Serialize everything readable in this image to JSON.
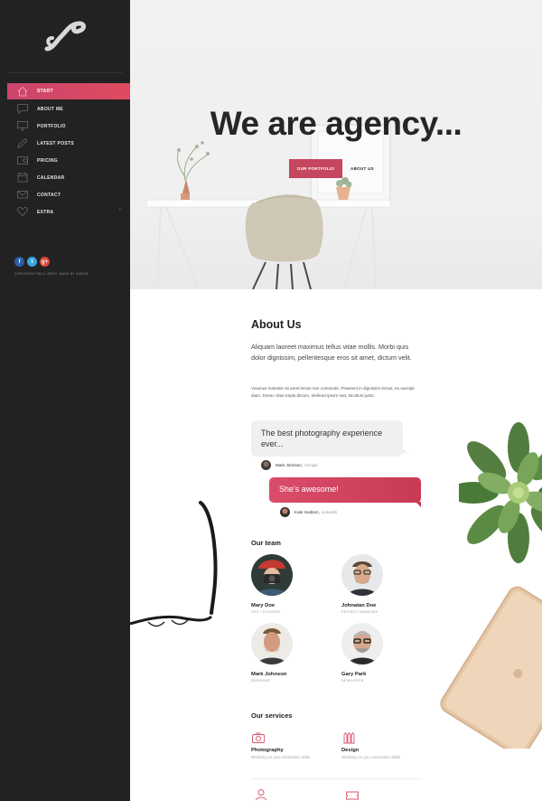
{
  "sidebar": {
    "items": [
      {
        "label": "START",
        "icon": "home-icon",
        "active": true
      },
      {
        "label": "ABOUT ME",
        "icon": "chat-icon"
      },
      {
        "label": "PORTFOLIO",
        "icon": "monitor-icon"
      },
      {
        "label": "LATEST POSTS",
        "icon": "pen-icon"
      },
      {
        "label": "PRICING",
        "icon": "wallet-icon"
      },
      {
        "label": "CALENDAR",
        "icon": "calendar-icon"
      },
      {
        "label": "CONTACT",
        "icon": "mail-icon"
      },
      {
        "label": "EXTRA",
        "icon": "heart-icon",
        "chevron": "›"
      }
    ],
    "socials": [
      {
        "glyph": "f",
        "icon": "facebook-icon"
      },
      {
        "glyph": "t",
        "icon": "twitter-icon"
      },
      {
        "glyph": "g+",
        "icon": "google-plus-icon"
      }
    ],
    "copyright": "COPYRIGHT SKILL ZERO. MADE BY SUBUS."
  },
  "hero": {
    "title": "We are agency...",
    "primary_button": "OUR PORTFOLIO",
    "secondary_button": "ABOUT US"
  },
  "about": {
    "title": "About Us",
    "lead": "Aliquam laoreet maximus tellus vitae mollis. Morbi quis dolor dignissim, pellentesque eros sit amet, dictum velit.",
    "body": "Vivamus molestie sit amet lectus non commodo. Praesent in dignissim lectus, eu suscipit diam. Donec vitae turpis dictum, eleifend ipsum sed, tincidunt justo."
  },
  "testimonials": [
    {
      "quote": "The best photography experience ever...",
      "author": "Mark Johnson,",
      "company": "Google"
    },
    {
      "quote": "She's awesome!",
      "author": "Kate Hudson,",
      "company": "LinkedIn"
    }
  ],
  "team": {
    "title": "Our team",
    "members": [
      {
        "name": "Mary Doe",
        "role": "CEO / FOUNDER"
      },
      {
        "name": "Johnatan Doe",
        "role": "PROJECT MANAGER"
      },
      {
        "name": "Mark Johnson",
        "role": "DESIGNER"
      },
      {
        "name": "Gary Park",
        "role": "DEVELOPER"
      }
    ]
  },
  "services": {
    "title": "Our services",
    "items": [
      {
        "title": "Photography",
        "desc": "Working on you motivation skills",
        "icon": "camera-icon"
      },
      {
        "title": "Design",
        "desc": "Working on you motivation skills",
        "icon": "pencils-icon"
      }
    ]
  },
  "colors": {
    "accent": "#c9466c",
    "sidebar": "#222222"
  }
}
